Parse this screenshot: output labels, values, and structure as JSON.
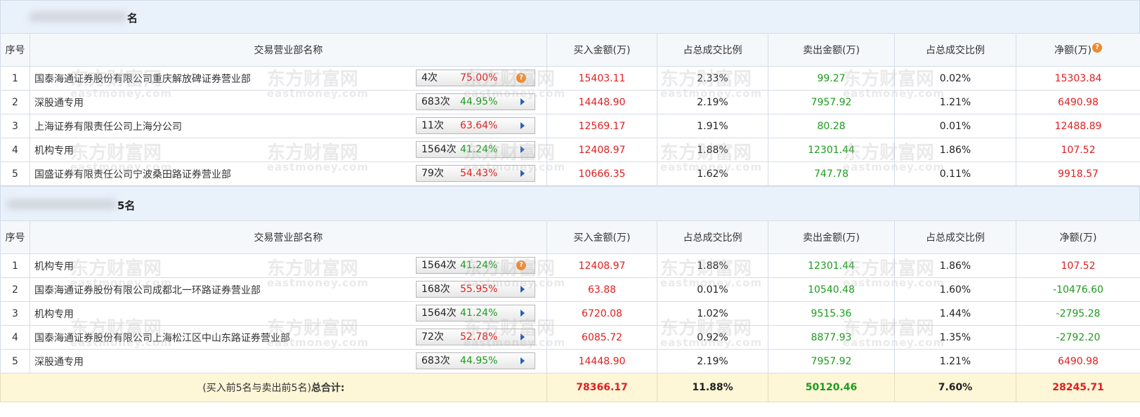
{
  "buy_section": {
    "title": "名",
    "columns": [
      "序号",
      "交易营业部名称",
      "买入金额(万)",
      "占总成交比例",
      "卖出金额(万)",
      "占总成交比例",
      "净额(万)"
    ],
    "net_help_icon": "?",
    "rows": [
      {
        "rank": "1",
        "name": "国泰海通证券股份有限公司重庆解放碑证券营业部",
        "count": "4次",
        "rate": "75.00%",
        "rate_color": "red",
        "tag_icon": "help-icon",
        "buy": "15403.11",
        "buy_ratio": "2.33%",
        "sell": "99.27",
        "sell_ratio": "0.02%",
        "net": "15303.84",
        "net_color": "red"
      },
      {
        "rank": "2",
        "name": "深股通专用",
        "count": "683次",
        "rate": "44.95%",
        "rate_color": "green",
        "tag_icon": "arrow-right-icon",
        "buy": "14448.90",
        "buy_ratio": "2.19%",
        "sell": "7957.92",
        "sell_ratio": "1.21%",
        "net": "6490.98",
        "net_color": "red"
      },
      {
        "rank": "3",
        "name": "上海证券有限责任公司上海分公司",
        "count": "11次",
        "rate": "63.64%",
        "rate_color": "red",
        "tag_icon": "arrow-right-icon",
        "buy": "12569.17",
        "buy_ratio": "1.91%",
        "sell": "80.28",
        "sell_ratio": "0.01%",
        "net": "12488.89",
        "net_color": "red"
      },
      {
        "rank": "4",
        "name": "机构专用",
        "count": "1564次",
        "rate": "41.24%",
        "rate_color": "green",
        "tag_icon": "arrow-right-icon",
        "buy": "12408.97",
        "buy_ratio": "1.88%",
        "sell": "12301.44",
        "sell_ratio": "1.86%",
        "net": "107.52",
        "net_color": "red"
      },
      {
        "rank": "5",
        "name": "国盛证券有限责任公司宁波桑田路证券营业部",
        "count": "79次",
        "rate": "54.43%",
        "rate_color": "red",
        "tag_icon": "arrow-right-icon",
        "buy": "10666.35",
        "buy_ratio": "1.62%",
        "sell": "747.78",
        "sell_ratio": "0.11%",
        "net": "9918.57",
        "net_color": "red"
      }
    ]
  },
  "sell_section": {
    "title": "5名",
    "columns": [
      "序号",
      "交易营业部名称",
      "买入金额(万)",
      "占总成交比例",
      "卖出金额(万)",
      "占总成交比例",
      "净额(万)"
    ],
    "rows": [
      {
        "rank": "1",
        "name": "机构专用",
        "count": "1564次",
        "rate": "41.24%",
        "rate_color": "green",
        "tag_icon": "help-icon",
        "buy": "12408.97",
        "buy_ratio": "1.88%",
        "sell": "12301.44",
        "sell_ratio": "1.86%",
        "net": "107.52",
        "net_color": "red"
      },
      {
        "rank": "2",
        "name": "国泰海通证券股份有限公司成都北一环路证券营业部",
        "count": "168次",
        "rate": "55.95%",
        "rate_color": "red",
        "tag_icon": "arrow-right-icon",
        "buy": "63.88",
        "buy_ratio": "0.01%",
        "sell": "10540.48",
        "sell_ratio": "1.60%",
        "net": "-10476.60",
        "net_color": "green"
      },
      {
        "rank": "3",
        "name": "机构专用",
        "count": "1564次",
        "rate": "41.24%",
        "rate_color": "green",
        "tag_icon": "arrow-right-icon",
        "buy": "6720.08",
        "buy_ratio": "1.02%",
        "sell": "9515.36",
        "sell_ratio": "1.44%",
        "net": "-2795.28",
        "net_color": "green"
      },
      {
        "rank": "4",
        "name": "国泰海通证券股份有限公司上海松江区中山东路证券营业部",
        "count": "72次",
        "rate": "52.78%",
        "rate_color": "red",
        "tag_icon": "arrow-right-icon",
        "buy": "6085.72",
        "buy_ratio": "0.92%",
        "sell": "8877.93",
        "sell_ratio": "1.35%",
        "net": "-2792.20",
        "net_color": "green"
      },
      {
        "rank": "5",
        "name": "深股通专用",
        "count": "683次",
        "rate": "44.95%",
        "rate_color": "green",
        "tag_icon": "arrow-right-icon",
        "buy": "14448.90",
        "buy_ratio": "2.19%",
        "sell": "7957.92",
        "sell_ratio": "1.21%",
        "net": "6490.98",
        "net_color": "red"
      }
    ],
    "total": {
      "label_prefix": "(买入前5名与卖出前5名)",
      "label_bold": "总合计:",
      "buy": "78366.17",
      "buy_ratio": "11.88%",
      "sell": "50120.46",
      "sell_ratio": "7.60%",
      "net": "28245.71"
    }
  },
  "watermark": {
    "cn": "东方财富网",
    "en": "eastmoney.com"
  },
  "colors": {
    "red": "#e01f1f",
    "green": "#1e9b1e",
    "header_bg": "#e9f1fb",
    "total_bg": "#fdf6d7",
    "border": "#d5dde6"
  }
}
